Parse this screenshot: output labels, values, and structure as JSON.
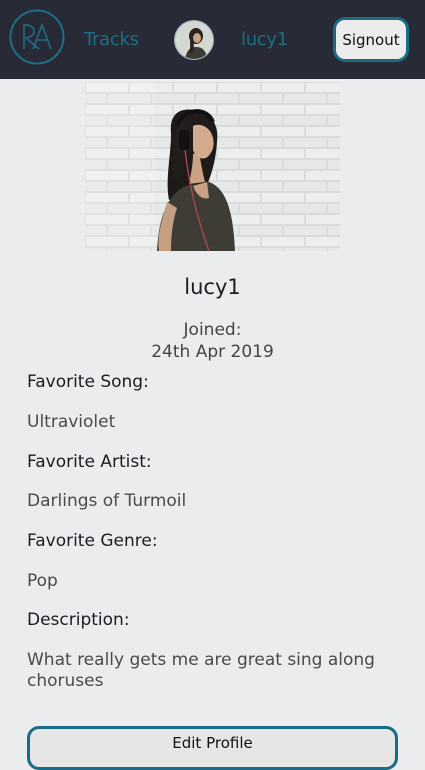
{
  "navbar": {
    "logo_text": "RA",
    "tracks_link": "Tracks",
    "username": "lucy1",
    "signout_label": "Signout"
  },
  "profile": {
    "username": "lucy1",
    "joined_label": "Joined:",
    "joined_date": "24th Apr 2019",
    "favorite_song_label": "Favorite Song:",
    "favorite_song": "Ultraviolet",
    "favorite_artist_label": "Favorite Artist:",
    "favorite_artist": "Darlings of Turmoil",
    "favorite_genre_label": "Favorite Genre:",
    "favorite_genre": "Pop",
    "description_label": "Description:",
    "description": "What really gets me are great sing along choruses",
    "edit_button_label": "Edit Profile"
  },
  "colors": {
    "navbar_bg": "#282a35",
    "accent": "#1b6f86",
    "page_bg": "#ebecee"
  }
}
